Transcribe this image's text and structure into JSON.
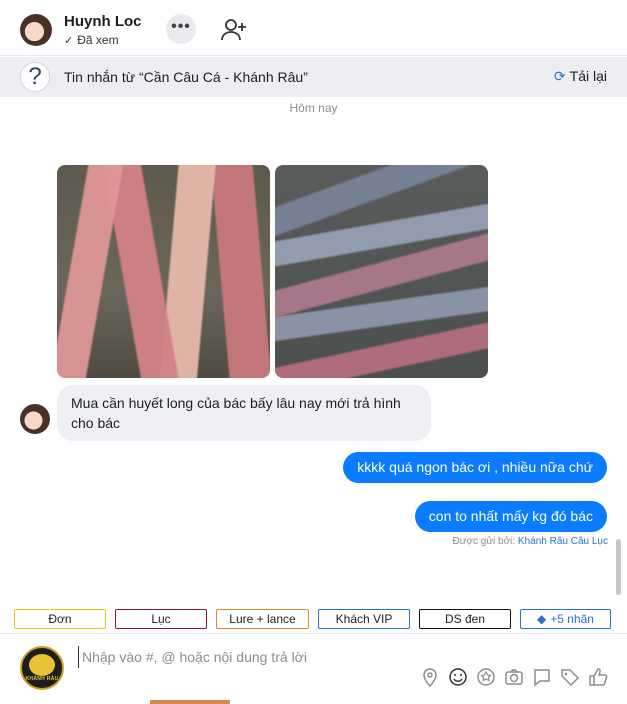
{
  "header": {
    "contact_name": "Huynh Loc",
    "seen_status": "Đã xem",
    "more_label": "•••",
    "icons": {
      "avatar": "avatar-photo",
      "more": "more-icon",
      "add_user": "add-user-icon",
      "seen": "check-icon"
    }
  },
  "source_bar": {
    "title": "Tin nhắn từ  “Cần Câu Cá - Khánh Râu”",
    "reload_label": "Tải lại",
    "icons": {
      "help": "question-icon",
      "reload": "reload-icon"
    }
  },
  "chat": {
    "day_label": "Hôm nay",
    "incoming_message": "Mua cần huyết long của bác bấy lâu nay mới trả hình cho bác",
    "outgoing_messages": [
      "kkkk quá ngon bác ơi , nhiều nữa chứ",
      "con to nhất mấy kg đó bác"
    ],
    "sent_by_prefix": "Được gửi bởi: ",
    "sent_by_name": "Khánh Râu Câu Lục",
    "bubble_color_out": "#0a7cff",
    "bubble_color_in": "#eef0f3"
  },
  "tags": [
    {
      "label": "Đơn",
      "color": "#e5c71a"
    },
    {
      "label": "Lục",
      "color": "#8b1a2a"
    },
    {
      "label": "Lure + lance",
      "color": "#e0892b"
    },
    {
      "label": "Khách VIP",
      "color": "#2a71d0"
    },
    {
      "label": "DS đen",
      "color": "#111111"
    },
    {
      "label": "+5 nhãn",
      "color": "#2a71d0"
    }
  ],
  "composer": {
    "placeholder": "Nhập vào #, @ hoặc nội dung trả lời",
    "logo_text": "KHÁNH RÂU",
    "tool_icons": [
      "location-icon",
      "emoji-icon",
      "sticker-icon",
      "camera-icon",
      "chat-icon",
      "tag-icon",
      "like-icon"
    ]
  }
}
